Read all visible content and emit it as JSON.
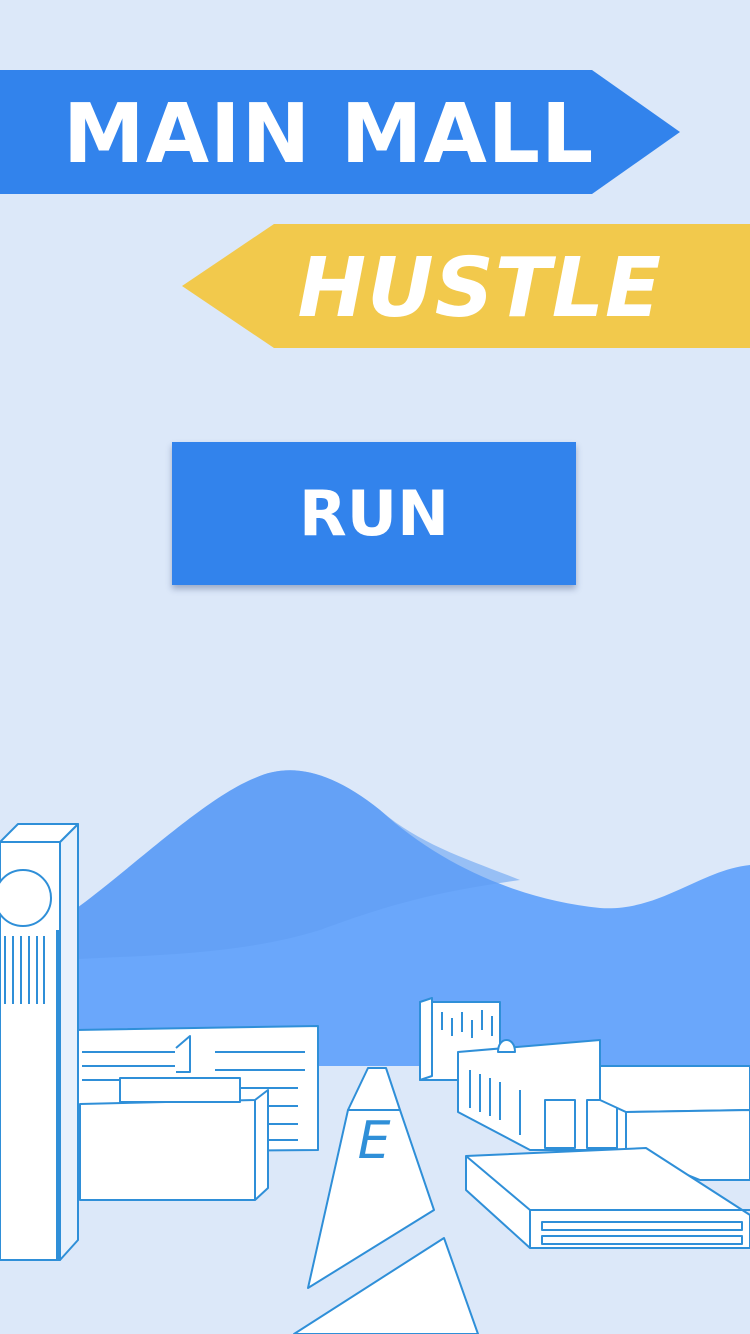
{
  "game": {
    "title_line1": "MAIN MALL",
    "title_line2": "HUSTLE",
    "run_label": "RUN",
    "road_sign_letter": "E"
  },
  "colors": {
    "background": "#dce8f9",
    "primary_blue": "#3283ec",
    "accent_yellow": "#f2c94c",
    "mountain_dark": "#5f9cf2",
    "mountain_light": "#6aa7fb",
    "building_outline": "#2f8fd8",
    "text": "#ffffff"
  }
}
